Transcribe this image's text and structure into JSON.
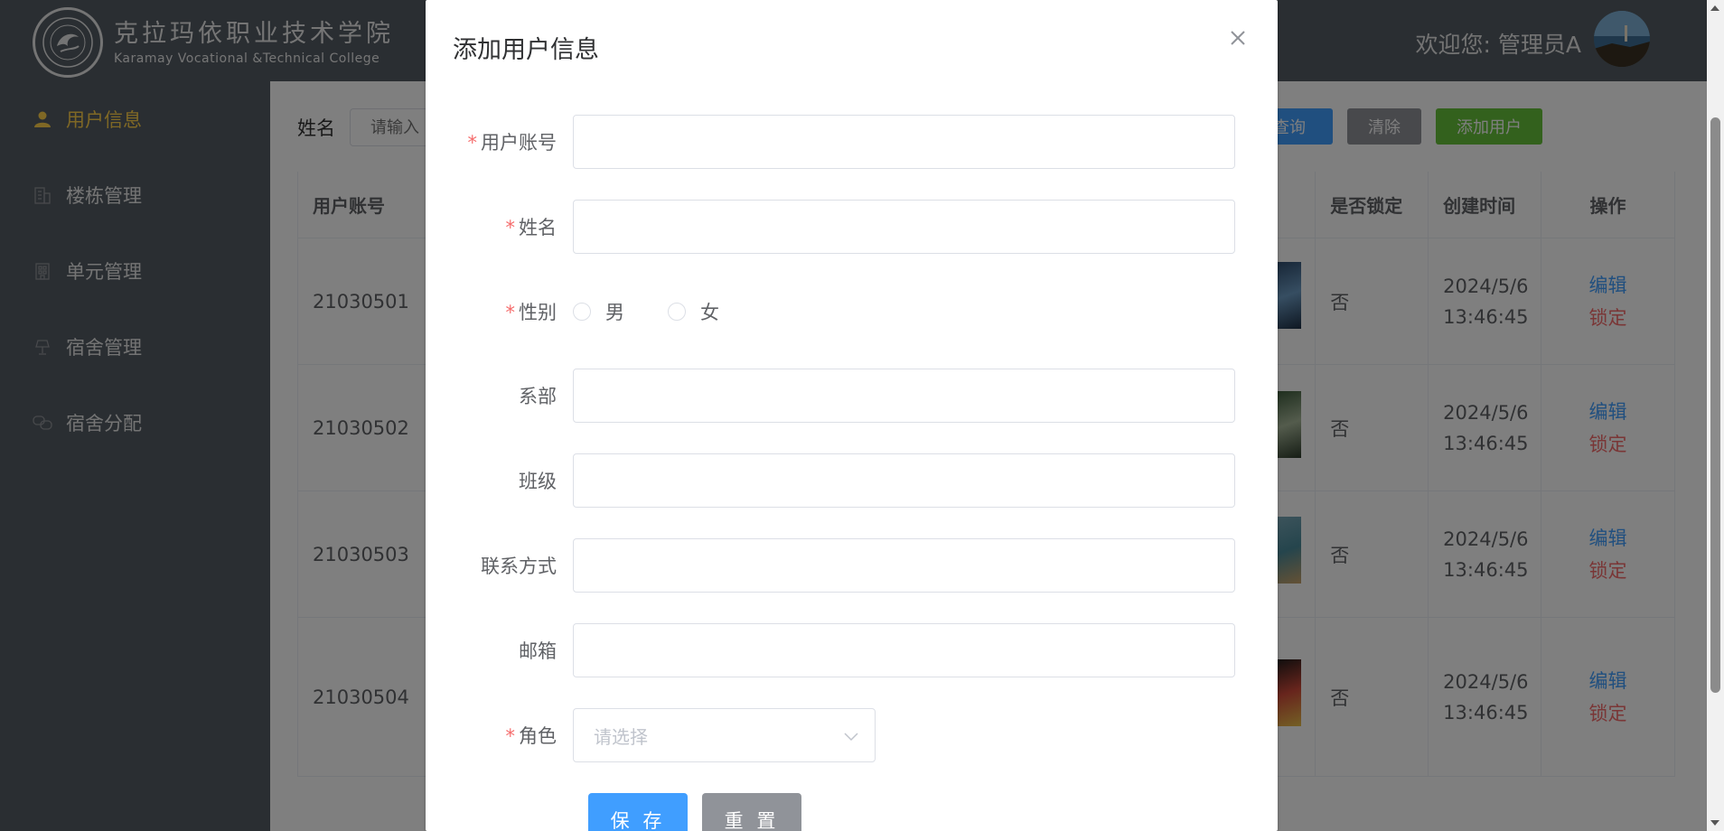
{
  "header": {
    "school_name_cn": "克拉玛依职业技术学院",
    "school_name_en": "Karamay Vocational &Technical College",
    "welcome": "欢迎您: 管理员A"
  },
  "sidebar": {
    "items": [
      {
        "label": "用户信息",
        "icon": "user-icon",
        "active": true
      },
      {
        "label": "楼栋管理",
        "icon": "building-icon"
      },
      {
        "label": "单元管理",
        "icon": "office-icon"
      },
      {
        "label": "宿舍管理",
        "icon": "lamp-icon"
      },
      {
        "label": "宿舍分配",
        "icon": "link-icon"
      }
    ]
  },
  "search": {
    "label": "姓名",
    "placeholder": "请输入",
    "query_label": "查询",
    "clear_label": "清除",
    "add_label": "添加用户"
  },
  "table": {
    "headers": {
      "account": "用户账号",
      "locked": "是否锁定",
      "created": "创建时间",
      "operation": "操作"
    },
    "rows": [
      {
        "account": "21030501",
        "locked": "否",
        "date": "2024/5/6",
        "time": "13:46:45",
        "edit": "编辑",
        "lock": "锁定"
      },
      {
        "account": "21030502",
        "locked": "否",
        "date": "2024/5/6",
        "time": "13:46:45",
        "edit": "编辑",
        "lock": "锁定"
      },
      {
        "account": "21030503",
        "locked": "否",
        "date": "2024/5/6",
        "time": "13:46:45",
        "edit": "编辑",
        "lock": "锁定"
      },
      {
        "account": "21030504",
        "locked": "否",
        "date": "2024/5/6",
        "time": "13:46:45",
        "edit": "编辑",
        "lock": "锁定"
      }
    ]
  },
  "dialog": {
    "title": "添加用户信息",
    "fields": {
      "account": {
        "label": "用户账号",
        "required": true,
        "value": ""
      },
      "name": {
        "label": "姓名",
        "required": true,
        "value": ""
      },
      "gender": {
        "label": "性别",
        "required": true,
        "options": [
          "男",
          "女"
        ]
      },
      "department": {
        "label": "系部",
        "value": ""
      },
      "class": {
        "label": "班级",
        "value": ""
      },
      "contact": {
        "label": "联系方式",
        "value": ""
      },
      "email": {
        "label": "邮箱",
        "value": ""
      },
      "role": {
        "label": "角色",
        "required": true,
        "placeholder": "请选择"
      }
    },
    "save_label": "保 存",
    "reset_label": "重 置"
  },
  "colors": {
    "sidebar_bg": "#545c64",
    "active": "#ffd04b",
    "primary": "#409eff",
    "success": "#67c23a",
    "info": "#909399",
    "danger": "#f56c6c"
  }
}
